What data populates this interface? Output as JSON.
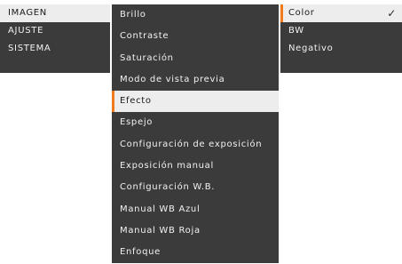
{
  "main_menu": [
    {
      "label": "IMAGEN",
      "selected": true
    },
    {
      "label": "AJUSTE",
      "selected": false
    },
    {
      "label": "SISTEMA",
      "selected": false
    }
  ],
  "sub_menu": [
    {
      "label": "Brillo"
    },
    {
      "label": "Contraste"
    },
    {
      "label": "Saturación"
    },
    {
      "label": "Modo de vista previa"
    },
    {
      "label": "Efecto",
      "selected": true
    },
    {
      "label": "Espejo"
    },
    {
      "label": "Configuración de exposición"
    },
    {
      "label": "Exposición manual"
    },
    {
      "label": "Configuración W.B."
    },
    {
      "label": "Manual WB Azul"
    },
    {
      "label": "Manual WB Roja"
    },
    {
      "label": "Enfoque"
    }
  ],
  "effect_menu": [
    {
      "label": "Color",
      "selected": true,
      "checked": true,
      "check_icon": "checkmark-icon"
    },
    {
      "label": "BW"
    },
    {
      "label": "Negativo"
    }
  ],
  "colors": {
    "menu_bg": "#3b3b3b",
    "selected_bg": "#ededed",
    "accent": "#f07a1c"
  }
}
